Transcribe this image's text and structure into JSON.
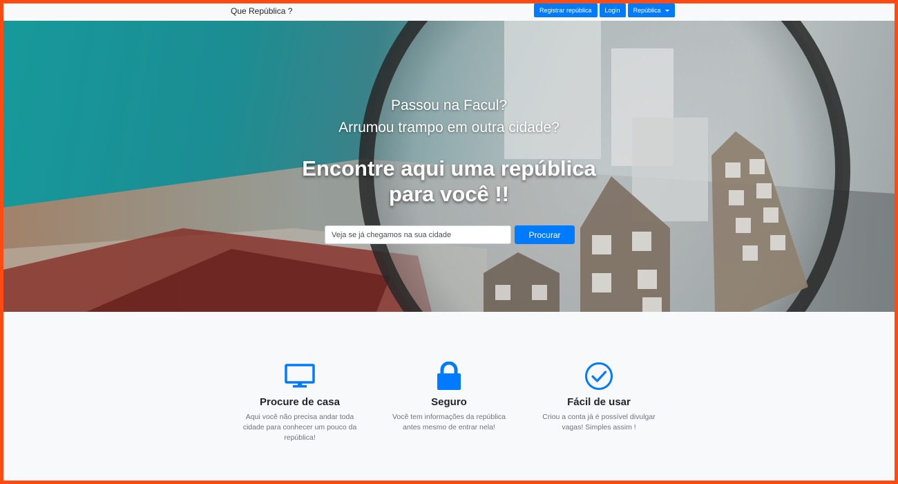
{
  "navbar": {
    "brand": "Que República ?",
    "register_label": "Registrar república",
    "login_label": "Login",
    "dropdown_label": "República"
  },
  "hero": {
    "line1": "Passou na Facul?",
    "line2": "Arrumou trampo em outra cidade?",
    "title_line1": "Encontre aqui uma república",
    "title_line2": "para você !!",
    "search_placeholder": "Veja se já chegamos na sua cidade",
    "search_button": "Procurar"
  },
  "features": [
    {
      "icon": "monitor-icon",
      "title": "Procure de casa",
      "text_lines": [
        "Aqui você não precisa andar toda",
        "cidade para conhecer um pouco da",
        "república!"
      ]
    },
    {
      "icon": "lock-icon",
      "title": "Seguro",
      "text_lines": [
        "Você tem informações da república",
        "antes mesmo de entrar nela!"
      ]
    },
    {
      "icon": "check-circle-icon",
      "title": "Fácil de usar",
      "text_lines": [
        "Criou a conta já é possível divulgar",
        "vagas! Simples assim !"
      ]
    }
  ],
  "colors": {
    "accent": "#007bff",
    "frame_border": "#ff4a12",
    "page_background": "#f8f9fa"
  }
}
